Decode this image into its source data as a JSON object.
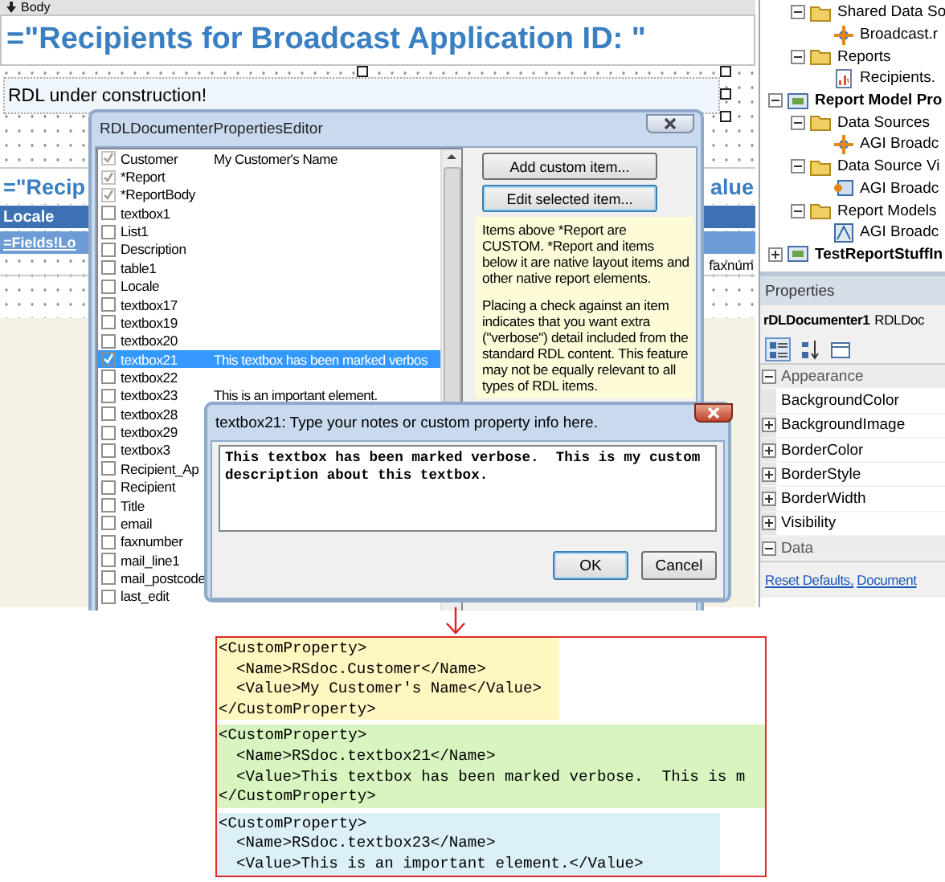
{
  "designer": {
    "tab": "Body",
    "title": "=\"Recipients for Broadcast Application ID: \"",
    "textbox": "RDL under construction!",
    "table_title_start": "=\"Recip",
    "table_title_end": "alue",
    "header_cell": "Locale",
    "detail_cell": "=Fields!Lo",
    "column_cell": "faxnum"
  },
  "editor": {
    "title": "RDLDocumenterPropertiesEditor",
    "items": [
      {
        "name": "Customer",
        "value": "My Customer's Name",
        "checked": true,
        "disabled": true,
        "selected": false
      },
      {
        "name": "*Report",
        "checked": true,
        "disabled": true,
        "selected": false
      },
      {
        "name": "*ReportBody",
        "checked": true,
        "disabled": true,
        "selected": false
      },
      {
        "name": "textbox1",
        "checked": false,
        "disabled": false,
        "selected": false
      },
      {
        "name": "List1",
        "checked": false,
        "disabled": false,
        "selected": false
      },
      {
        "name": "Description",
        "checked": false,
        "disabled": false,
        "selected": false
      },
      {
        "name": "table1",
        "checked": false,
        "disabled": false,
        "selected": false
      },
      {
        "name": "Locale",
        "checked": false,
        "disabled": false,
        "selected": false
      },
      {
        "name": "textbox17",
        "checked": false,
        "disabled": false,
        "selected": false
      },
      {
        "name": "textbox19",
        "checked": false,
        "disabled": false,
        "selected": false
      },
      {
        "name": "textbox20",
        "checked": false,
        "disabled": false,
        "selected": false
      },
      {
        "name": "textbox21",
        "value": "This textbox has been marked verbos",
        "checked": true,
        "disabled": false,
        "selected": true
      },
      {
        "name": "textbox22",
        "checked": false,
        "disabled": false,
        "selected": false
      },
      {
        "name": "textbox23",
        "value": "This is an important element.",
        "checked": false,
        "disabled": false,
        "selected": false
      },
      {
        "name": "textbox28",
        "checked": false,
        "disabled": false,
        "selected": false
      },
      {
        "name": "textbox29",
        "checked": false,
        "disabled": false,
        "selected": false
      },
      {
        "name": "textbox3",
        "checked": false,
        "disabled": false,
        "selected": false
      },
      {
        "name": "Recipient_Ap",
        "checked": false,
        "disabled": false,
        "selected": false
      },
      {
        "name": "Recipient",
        "checked": false,
        "disabled": false,
        "selected": false
      },
      {
        "name": "Title",
        "checked": false,
        "disabled": false,
        "selected": false
      },
      {
        "name": "email",
        "checked": false,
        "disabled": false,
        "selected": false
      },
      {
        "name": "faxnumber",
        "checked": false,
        "disabled": false,
        "selected": false
      },
      {
        "name": "mail_line1",
        "checked": false,
        "disabled": false,
        "selected": false
      },
      {
        "name": "mail_postcode",
        "checked": false,
        "disabled": false,
        "selected": false
      },
      {
        "name": "last_edit",
        "checked": false,
        "disabled": false,
        "selected": false
      }
    ],
    "buttons": [
      {
        "label": "Add custom item...",
        "focused": false
      },
      {
        "label": "Edit selected item...",
        "focused": true
      }
    ],
    "note": [
      "Items above *Report are CUSTOM. *Report and items below it are native layout items and other native report elements.",
      "Placing a check against an item indicates that you want extra (\"verbose\") detail included from the standard RDL content. This feature may not be equally relevant to all types of RDL items."
    ]
  },
  "notes_dialog": {
    "title": "textbox21: Type your notes or custom property info here.",
    "value": "This textbox has been marked verbose.  This is my custom description about this textbox.",
    "buttons": [
      {
        "label": "OK",
        "default": true
      },
      {
        "label": "Cancel",
        "default": false
      }
    ]
  },
  "solution_explorer": {
    "continued_items": [
      {
        "label": "Shared Data So",
        "kind": "folder",
        "expanded": true,
        "children": [
          {
            "label": "Broadcast.r",
            "kind": "datasource"
          }
        ]
      },
      {
        "label": "Reports",
        "kind": "folder",
        "expanded": true,
        "children": [
          {
            "label": "Recipients.",
            "kind": "report"
          }
        ]
      }
    ],
    "items": [
      {
        "label": "Report Model Pro",
        "kind": "project",
        "expanded": true,
        "children": [
          {
            "label": "Data Sources",
            "kind": "folder",
            "expanded": true,
            "children": [
              {
                "label": "AGI Broadc",
                "kind": "datasource"
              }
            ]
          },
          {
            "label": "Data Source Vi",
            "kind": "folder",
            "expanded": true,
            "children": [
              {
                "label": "AGI Broadc",
                "kind": "view"
              }
            ]
          },
          {
            "label": "Report Models",
            "kind": "folder",
            "expanded": true,
            "children": [
              {
                "label": "AGI Broadc",
                "kind": "model"
              }
            ]
          }
        ]
      },
      {
        "label": "TestReportStuffIn",
        "kind": "project",
        "expanded": false
      }
    ]
  },
  "properties": {
    "title": "Properties",
    "object": "rDLDocumenter1",
    "object_type": "RDLDoc",
    "toolbar": [
      {
        "kind": "categorized",
        "selected": true
      },
      {
        "kind": "alphabetical",
        "selected": false
      },
      {
        "kind": "pages",
        "selected": false
      }
    ],
    "rows": [
      {
        "kind": "category",
        "label": "Appearance",
        "expanded": true
      },
      {
        "kind": "property",
        "label": "BackgroundColor"
      },
      {
        "kind": "group",
        "label": "BackgroundImage",
        "expanded": false
      },
      {
        "kind": "group",
        "label": "BorderColor",
        "expanded": false
      },
      {
        "kind": "group",
        "label": "BorderStyle",
        "expanded": false
      },
      {
        "kind": "group",
        "label": "BorderWidth",
        "expanded": false
      },
      {
        "kind": "group",
        "label": "Visibility",
        "expanded": false
      },
      {
        "kind": "category",
        "label": "Data",
        "expanded": true
      }
    ],
    "links": [
      "Reset Defaults,",
      "Document"
    ]
  },
  "xml_blocks": [
    {
      "color": "#fff6c0",
      "open": "<CustomProperty>",
      "lines": [
        "<Name>RSdoc.Customer</Name>",
        "<Value>My Customer's Name</Value>"
      ],
      "close": "</CustomProperty>"
    },
    {
      "color": "#d8f5c0",
      "open": "<CustomProperty>",
      "lines": [
        "<Name>RSdoc.textbox21</Name>",
        "<Value>This textbox has been marked verbose.  This is m"
      ],
      "close": "</CustomProperty>"
    },
    {
      "color": "#dcf0f8",
      "open": "<CustomProperty>",
      "lines": [
        "<Name>RSdoc.textbox23</Name>",
        "<Value>This is an important element.</Value>"
      ]
    }
  ]
}
